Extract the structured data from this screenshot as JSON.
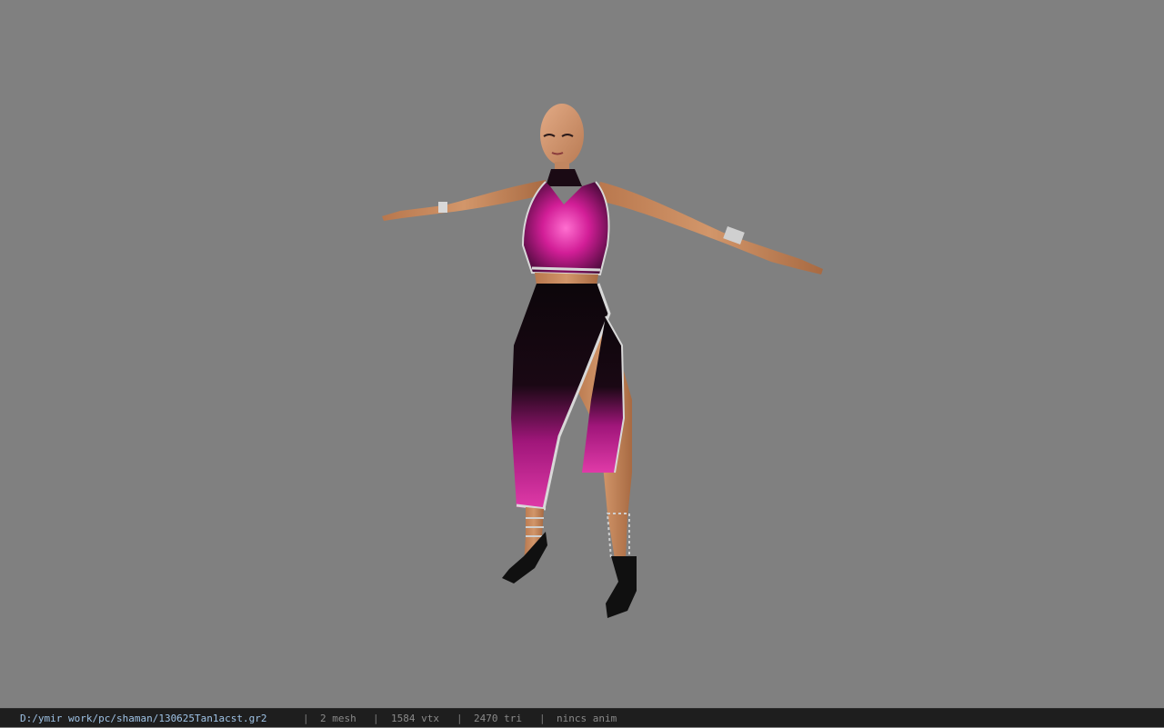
{
  "viewport": {
    "background_color": "#808080",
    "model_description_icon": "character-model"
  },
  "status_bar": {
    "file_path": "D:/ymir work/pc/shaman/130625Tan1acst.gr2",
    "separator": "|",
    "mesh_count": "2 mesh",
    "vertex_count": "1584 vtx",
    "triangle_count": "2470 tri",
    "animation_status": "nincs anim"
  },
  "colors": {
    "skin": "#c98a5e",
    "dress_pink": "#d6309a",
    "dress_black": "#120810",
    "trim_silver": "#d8d8d8"
  }
}
